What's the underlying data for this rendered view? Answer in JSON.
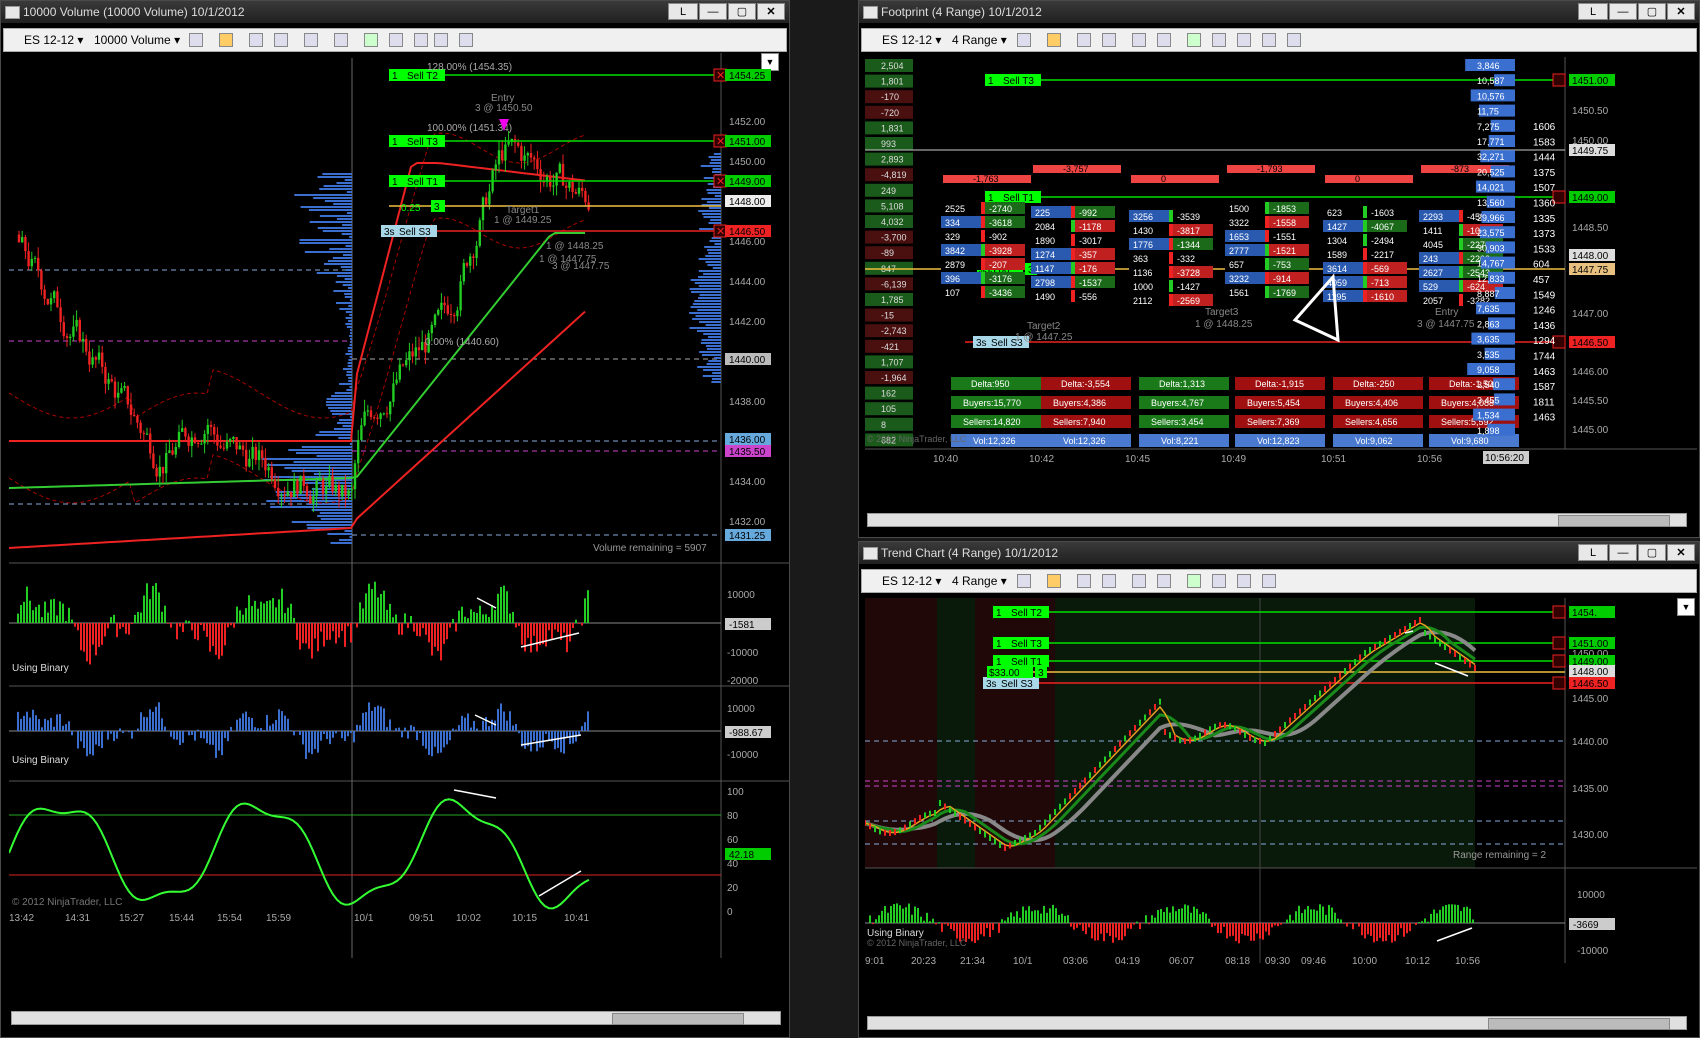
{
  "windows": {
    "left": {
      "title": "10000 Volume (10000 Volume)  10/1/2012",
      "instrument": "ES 12-12",
      "period": "10000 Volume"
    },
    "footprint": {
      "title": "Footprint (4 Range)  10/1/2012",
      "instrument": "ES 12-12",
      "period": "4 Range"
    },
    "trend": {
      "title": "Trend Chart (4 Range)  10/1/2012",
      "instrument": "ES 12-12",
      "period": "4 Range"
    },
    "button_l": "L"
  },
  "left_chart": {
    "price_labels": [
      "1454.25",
      "1452.00",
      "1451.00",
      "1450.00",
      "1449.00",
      "1448.00",
      "1446.50",
      "1446.00",
      "1444.00",
      "1442.00",
      "1440.00",
      "1438.00",
      "1436.00",
      "1435.50",
      "1434.00",
      "1432.00",
      "1431.25"
    ],
    "orders": [
      {
        "qty": "1",
        "label": "Sell T2",
        "color": "#00ff00"
      },
      {
        "qty": "1",
        "label": "Sell T3",
        "color": "#00ff00"
      },
      {
        "qty": "1",
        "label": "Sell T1",
        "color": "#00ff00"
      },
      {
        "qty": "3s",
        "label": "Sell S3",
        "color": "#a8d8e8"
      }
    ],
    "pos_qty": "3",
    "pos_val": "0.25",
    "texts": {
      "fib128": "128.00% (1454.35)",
      "fib100": "100.00% (1451.34)",
      "fib0": "0.00% (1440.60)",
      "entry": "Entry",
      "entry_at": "3 @ 1450.50",
      "target1": "Target1",
      "target1_at": "1 @ 1449.25",
      "target2_at": "1 @ 1448.25",
      "target3_at": "1 @ 1447.75",
      "entry2_at": "3 @ 1447.75",
      "vol_remaining": "Volume remaining = 5907"
    },
    "ind1": {
      "label": "Using Binary",
      "levels": [
        "10000",
        "0",
        "-10000",
        "-20000"
      ],
      "last": "-1581"
    },
    "ind2": {
      "label": "Using Binary",
      "levels": [
        "10000",
        "0",
        "-10000"
      ],
      "last": "-988.67"
    },
    "ind3": {
      "levels": [
        "100",
        "80",
        "60",
        "40",
        "20",
        "0"
      ],
      "last": "42.18",
      "copyright": "© 2012 NinjaTrader, LLC"
    },
    "time_labels": [
      "13:42",
      "14:31",
      "15:27",
      "15:44",
      "15:54",
      "15:59",
      "10/1",
      "09:51",
      "10:02",
      "10:15",
      "10:41"
    ]
  },
  "footprint_chart": {
    "left_values": [
      "2,504",
      "1,801",
      "-170",
      "-720",
      "1,831",
      "993",
      "2,893",
      "-4,819",
      "249",
      "5,108",
      "4,032",
      "-3,700",
      "-89",
      "847",
      "-6,139",
      "1,785",
      "-15",
      "-2,743",
      "-421",
      "1,707",
      "-1,964",
      "162",
      "105",
      "8",
      "682"
    ],
    "right_values": [
      "3,846",
      "10,587",
      "10,576",
      "11,75",
      "7,275",
      "17,771",
      "32,271",
      "20,525",
      "14,021",
      "13,560",
      "29,966",
      "23,575",
      "30,903",
      "14,767",
      "12,833",
      "8,887",
      "7,635",
      "2,863",
      "3,635",
      "3,535",
      "9,058",
      "3,540",
      "3,455",
      "1,534",
      "1,898"
    ],
    "right_counts": [
      "1606",
      "1583",
      "1444",
      "1375",
      "1507",
      "1360",
      "1335",
      "1373",
      "1533",
      "604",
      "457",
      "1549",
      "1246",
      "1436",
      "1294",
      "1744",
      "1463",
      "1587",
      "1811",
      "1463"
    ],
    "price_labels": [
      "1451.00",
      "1450.50",
      "1450.00",
      "1449.75",
      "1449.00",
      "1448.50",
      "1448.00",
      "1447.75",
      "1447.00",
      "1446.50",
      "1446.00",
      "1445.50",
      "1445.00"
    ],
    "stats": [
      {
        "delta": "Delta:950",
        "buyers": "Buyers:15,770",
        "sellers": "Sellers:14,820",
        "vol": "Vol:12,326"
      },
      {
        "delta": "Delta:-3,554",
        "buyers": "Buyers:4,386",
        "sellers": "Sellers:7,940",
        "vol": "Vol:12,326"
      },
      {
        "delta": "Delta:1,313",
        "buyers": "Buyers:4,767",
        "sellers": "Sellers:3,454",
        "vol": "Vol:8,221"
      },
      {
        "delta": "Delta:-1,915",
        "buyers": "Buyers:5,454",
        "sellers": "Sellers:7,369",
        "vol": "Vol:12,823"
      },
      {
        "delta": "Delta:-250",
        "buyers": "Buyers:4,406",
        "sellers": "Sellers:4,656",
        "vol": "Vol:9,062"
      },
      {
        "delta": "Delta:-1,504",
        "buyers": "Buyers:4,088",
        "sellers": "Sellers:5,592",
        "vol": "Vol:9,680"
      }
    ],
    "time_labels": [
      "10:40",
      "10:42",
      "10:45",
      "10:49",
      "10:51",
      "10:56"
    ],
    "time_now": "10:56:20",
    "orders": [
      {
        "qty": "1",
        "label": "Sell T3"
      },
      {
        "qty": "1",
        "label": "Sell T1"
      },
      {
        "qty": "3s",
        "label": "Sell S3"
      }
    ],
    "pnl": "$33.00",
    "pos_qty": "3",
    "col_tops": [
      "-1,763",
      "-3,757",
      "0",
      "-1,793",
      "0",
      "-873"
    ],
    "texts": {
      "target2": "Target2",
      "target2_at": "1 @ 1447.25",
      "target3": "Target3",
      "target3_at": "1 @ 1448.25",
      "entry": "Entry",
      "entry_at": "3 @ 1447.75",
      "copyright": "© 2012 NinjaTrader, LLC"
    }
  },
  "trend_chart": {
    "orders": [
      {
        "qty": "1",
        "label": "Sell T2"
      },
      {
        "qty": "1",
        "label": "Sell T3"
      },
      {
        "qty": "1",
        "label": "Sell T1"
      },
      {
        "qty": "3s",
        "label": "Sell S3"
      }
    ],
    "pnl": "$33.00",
    "pos_qty": "3",
    "price_labels": [
      "1454.",
      "1451.00",
      "1450.00",
      "1449.00",
      "1448.00",
      "1446.50",
      "1445.00",
      "1440.00",
      "1435.00",
      "1430.00"
    ],
    "range_remaining": "Range remaining = 2",
    "ind": {
      "label": "Using Binary",
      "levels": [
        "10000",
        "0",
        "-10000"
      ],
      "last": "-3669",
      "copyright": "© 2012 NinjaTrader, LLC"
    },
    "time_labels": [
      "9:01",
      "20:23",
      "21:34",
      "10/1",
      "03:06",
      "04:19",
      "06:07",
      "08:18",
      "09:30",
      "09:46",
      "10:00",
      "10:12",
      "10:56"
    ]
  }
}
